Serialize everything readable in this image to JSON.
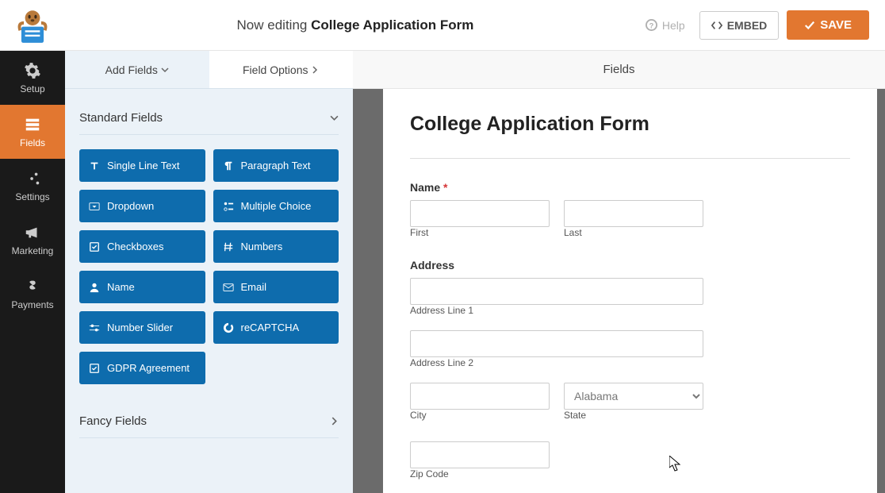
{
  "topbar": {
    "editing_prefix": "Now editing ",
    "form_name": "College Application Form",
    "help": "Help",
    "embed": "EMBED",
    "save": "SAVE"
  },
  "sidebar": {
    "setup": "Setup",
    "fields": "Fields",
    "settings": "Settings",
    "marketing": "Marketing",
    "payments": "Payments"
  },
  "canvas_title": "Fields",
  "panel": {
    "tab_add": "Add Fields",
    "tab_options": "Field Options",
    "section_standard": "Standard Fields",
    "section_fancy": "Fancy Fields",
    "fields": {
      "single_line": "Single Line Text",
      "paragraph": "Paragraph Text",
      "dropdown": "Dropdown",
      "multiple_choice": "Multiple Choice",
      "checkboxes": "Checkboxes",
      "numbers": "Numbers",
      "name": "Name",
      "email": "Email",
      "number_slider": "Number Slider",
      "recaptcha": "reCAPTCHA",
      "gdpr": "GDPR Agreement"
    }
  },
  "form": {
    "title": "College Application Form",
    "name_label": "Name",
    "first": "First",
    "last": "Last",
    "address_label": "Address",
    "addr1": "Address Line 1",
    "addr2": "Address Line 2",
    "city": "City",
    "state": "State",
    "state_default": "Alabama",
    "zip": "Zip Code"
  }
}
